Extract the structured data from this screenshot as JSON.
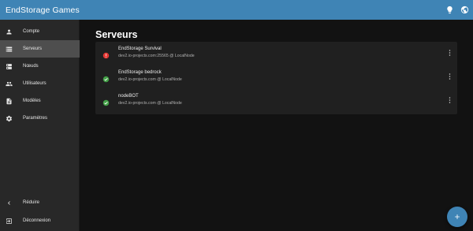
{
  "app": {
    "title": "EndStorage Games",
    "accent_color": "#3f84b5"
  },
  "topbar": {
    "icons": [
      "lightbulb-icon",
      "globe-icon"
    ]
  },
  "sidebar": {
    "items": [
      {
        "label": "Compte",
        "icon": "account-icon",
        "active": false
      },
      {
        "label": "Serveurs",
        "icon": "servers-icon",
        "active": true
      },
      {
        "label": "Nœuds",
        "icon": "nodes-icon",
        "active": false
      },
      {
        "label": "Utilisateurs",
        "icon": "users-icon",
        "active": false
      },
      {
        "label": "Modèles",
        "icon": "templates-icon",
        "active": false
      },
      {
        "label": "Paramètres",
        "icon": "settings-icon",
        "active": false
      }
    ],
    "footer": [
      {
        "label": "Réduire",
        "icon": "chevron-left-icon"
      },
      {
        "label": "Déconnexion",
        "icon": "logout-icon"
      }
    ]
  },
  "main": {
    "title": "Serveurs",
    "servers": [
      {
        "name": "EndStorage Survival",
        "address": "dev2.io-projects.com:25565 @ LocalNode",
        "status": "error",
        "status_color": "#e53935"
      },
      {
        "name": "EndStorage bedrock",
        "address": "dev2.io-projects.com @ LocalNode",
        "status": "online",
        "status_color": "#43a047"
      },
      {
        "name": "nodeBOT",
        "address": "dev2.io-projects.com @ LocalNode",
        "status": "online",
        "status_color": "#43a047"
      }
    ]
  },
  "fab": {
    "icon": "plus-icon"
  }
}
